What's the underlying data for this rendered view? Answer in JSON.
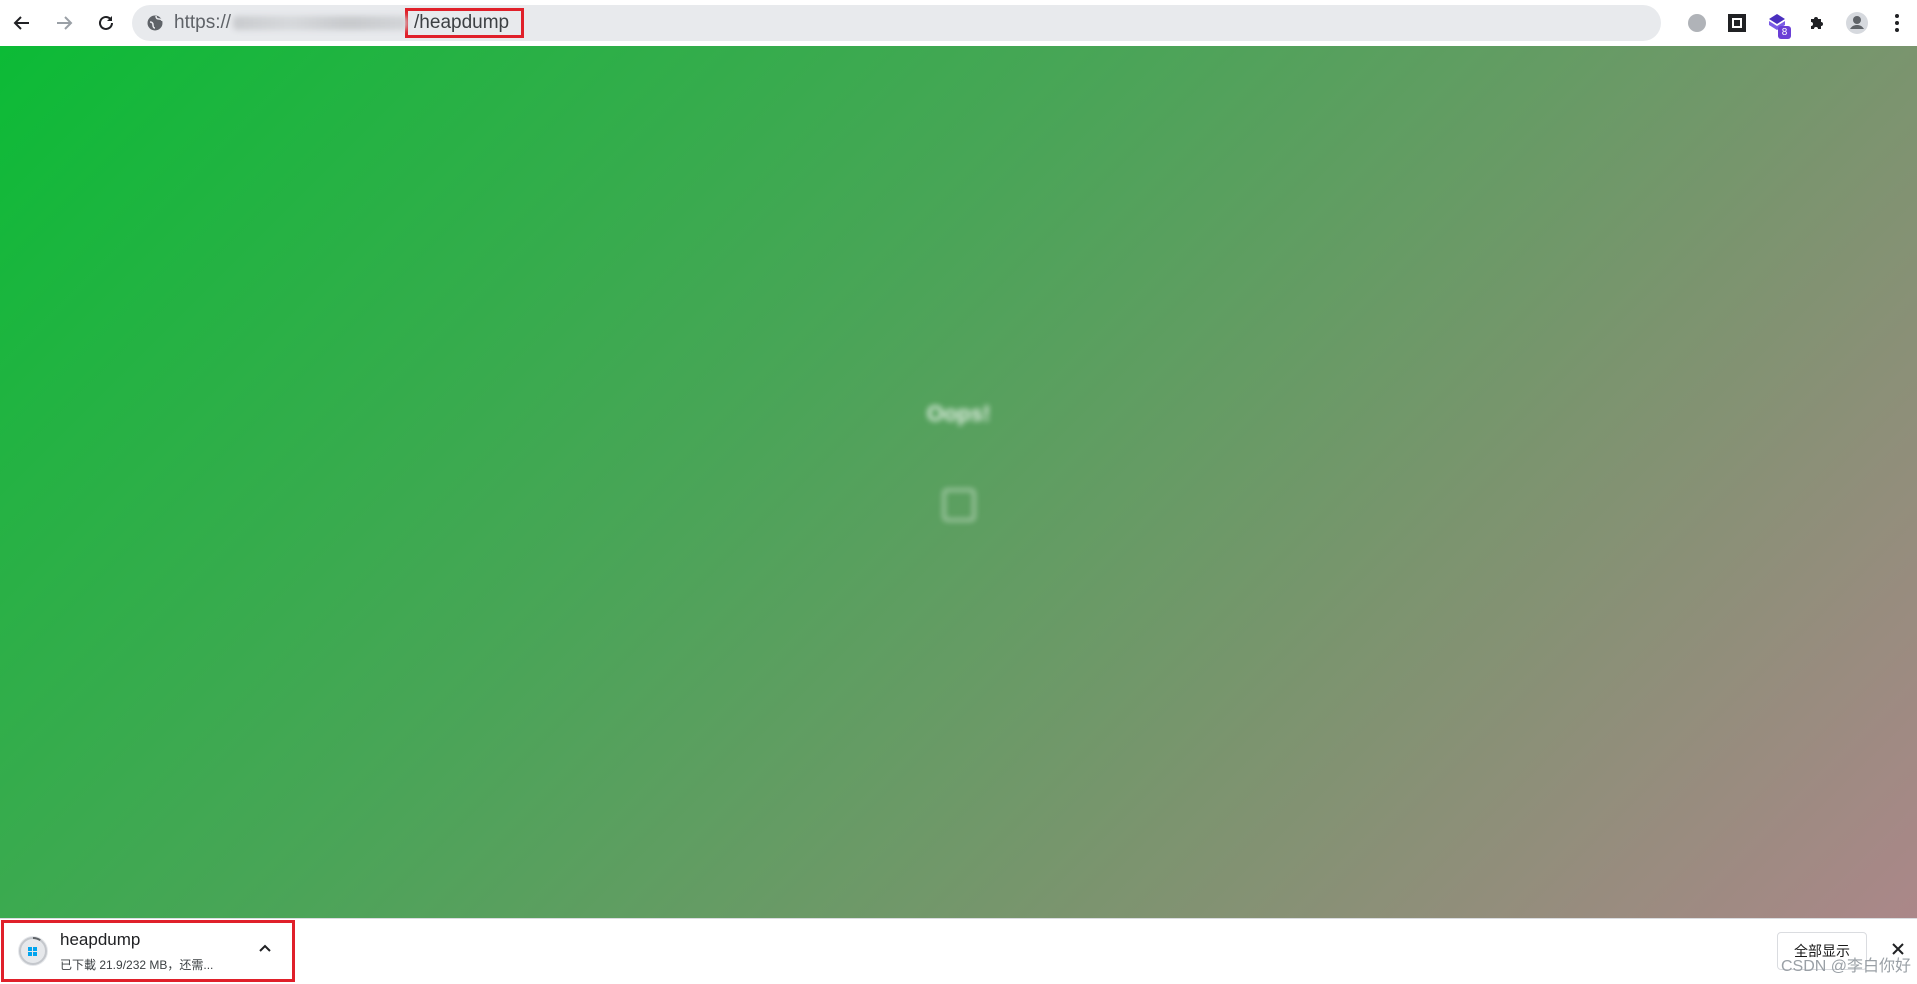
{
  "browser": {
    "url_scheme": "https://",
    "url_path": "/heapdump",
    "extensions_badge": "8",
    "icons": [
      "back-arrow-icon",
      "forward-arrow-icon",
      "reload-icon",
      "globe-icon",
      "circle-icon",
      "qr-square-icon",
      "extension-hexagon-icon",
      "puzzle-icon",
      "profile-icon",
      "kebab-menu-icon"
    ]
  },
  "page": {
    "title": "Oops!",
    "message": "",
    "button_label": ""
  },
  "downloads": {
    "file_name": "heapdump",
    "status": "已下載 21.9/232 MB，还需...",
    "progress": 0.094,
    "show_all_label": "全部显示",
    "watermark": "CSDN @李白你好"
  },
  "colors": {
    "highlight": "#e0202a",
    "gradient_start": "#0cbb36",
    "gradient_end": "#ab8789"
  }
}
